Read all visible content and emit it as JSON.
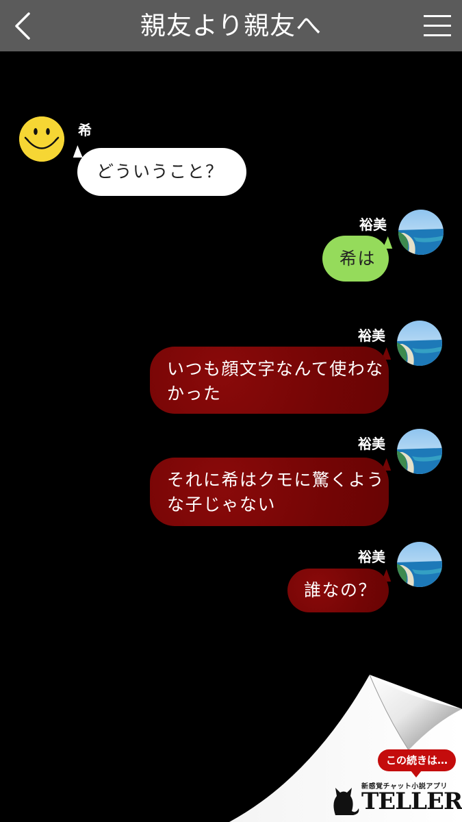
{
  "header": {
    "title": "親友より親友へ"
  },
  "messages": [
    {
      "sender": "希",
      "text": "どういうこと？",
      "style": "white",
      "side": "left"
    },
    {
      "sender": "裕美",
      "text": "希は",
      "style": "green",
      "side": "right"
    },
    {
      "sender": "裕美",
      "line1": "いつも顔文字なんて使わな",
      "line2": "かった",
      "style": "red",
      "side": "right"
    },
    {
      "sender": "裕美",
      "line1": "それに希はクモに驚くよう",
      "line2": "な子じゃない",
      "style": "red",
      "side": "right"
    },
    {
      "sender": "裕美",
      "text": "誰なの？",
      "style": "red",
      "side": "right"
    }
  ],
  "banner": {
    "continue_label": "この続きは…",
    "tagline": "新感覚チャット小説アプリ",
    "brand": "TELLER"
  },
  "colors": {
    "header_bg": "#5b5b5b",
    "green_bubble": "#95db5b",
    "red_bubble": "#740505",
    "badge_red": "#c40c0c"
  },
  "icons": {
    "back": "chevron-left-icon",
    "menu": "hamburger-menu-icon",
    "smiley_avatar": "smiley-face-icon",
    "beach_avatar": "beach-photo-avatar",
    "cat_logo": "cat-icon"
  }
}
